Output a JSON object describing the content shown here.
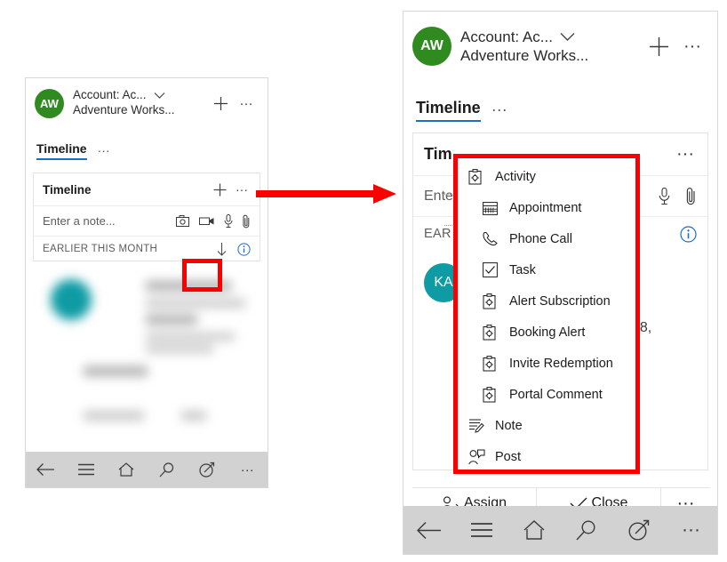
{
  "left_panel": {
    "account": {
      "initials": "AW",
      "line1": "Account: Ac...",
      "line2": "Adventure Works...",
      "chevron_icon": "chevron-down-icon",
      "add_icon": "plus-icon",
      "more_icon": "more-ellipsis-icon"
    },
    "tabs": {
      "active_label": "Timeline",
      "more_label": "···"
    },
    "timeline_card": {
      "title": "Timeline",
      "add_icon": "plus-icon",
      "more_icon": "more-ellipsis-icon",
      "note_placeholder": "Enter a note...",
      "note_icons": [
        "camera-icon",
        "video-icon",
        "microphone-icon",
        "attachment-icon"
      ],
      "section_label": "EARLIER THIS MONTH",
      "sort_icon": "arrow-down-icon",
      "info_icon": "info-circle-icon"
    },
    "navbar": {
      "items": [
        "back-arrow-icon",
        "hamburger-menu-icon",
        "home-icon",
        "search-icon",
        "pen-circle-icon",
        "more-ellipsis-icon"
      ]
    }
  },
  "arrow": {
    "name": "red-flow-arrow",
    "color": "#fc0000"
  },
  "right_panel": {
    "account": {
      "initials": "AW",
      "line1": "Account: Ac...",
      "line2": "Adventure Works...",
      "chevron_icon": "chevron-down-icon",
      "add_icon": "plus-icon",
      "more_icon": "more-ellipsis-icon"
    },
    "tabs": {
      "active_label": "Timeline",
      "more_label": "···"
    },
    "timeline_card": {
      "title_truncated": "Tim",
      "more_icon": "more-ellipsis-icon",
      "note_placeholder_truncated": "Ente",
      "note_icons": [
        "microphone-icon",
        "attachment-icon"
      ],
      "section_label_truncated": "EAR",
      "info_icon": "info-circle-icon",
      "record_initials": "KA",
      "record_date_fragment": "18,"
    },
    "context_menu": {
      "name": "create-timeline-record-menu",
      "items": [
        {
          "label": "Activity",
          "icon": "clipboard-gear-icon",
          "indented": false
        },
        {
          "label": "Appointment",
          "icon": "calendar-icon",
          "indented": true
        },
        {
          "label": "Phone Call",
          "icon": "phone-icon",
          "indented": true
        },
        {
          "label": "Task",
          "icon": "task-checkbox-icon",
          "indented": true
        },
        {
          "label": "Alert Subscription",
          "icon": "clipboard-gear-icon",
          "indented": true
        },
        {
          "label": "Booking Alert",
          "icon": "clipboard-gear-icon",
          "indented": true
        },
        {
          "label": "Invite Redemption",
          "icon": "clipboard-gear-icon",
          "indented": true
        },
        {
          "label": "Portal Comment",
          "icon": "clipboard-gear-icon",
          "indented": true
        },
        {
          "label": "Note",
          "icon": "note-pencil-icon",
          "indented": false
        },
        {
          "label": "Post",
          "icon": "post-person-icon",
          "indented": false
        }
      ]
    },
    "command_bar": {
      "assign_label": "Assign",
      "assign_icon": "assign-person-icon",
      "close_label": "Close",
      "close_icon": "check-icon",
      "more_icon": "more-ellipsis-icon"
    },
    "navbar": {
      "items": [
        "back-arrow-icon",
        "hamburger-menu-icon",
        "home-icon",
        "search-icon",
        "pen-circle-icon",
        "more-ellipsis-icon"
      ]
    }
  },
  "highlights": {
    "plus_button_box": "red-highlight-plus-button",
    "menu_box": "red-highlight-context-menu"
  }
}
